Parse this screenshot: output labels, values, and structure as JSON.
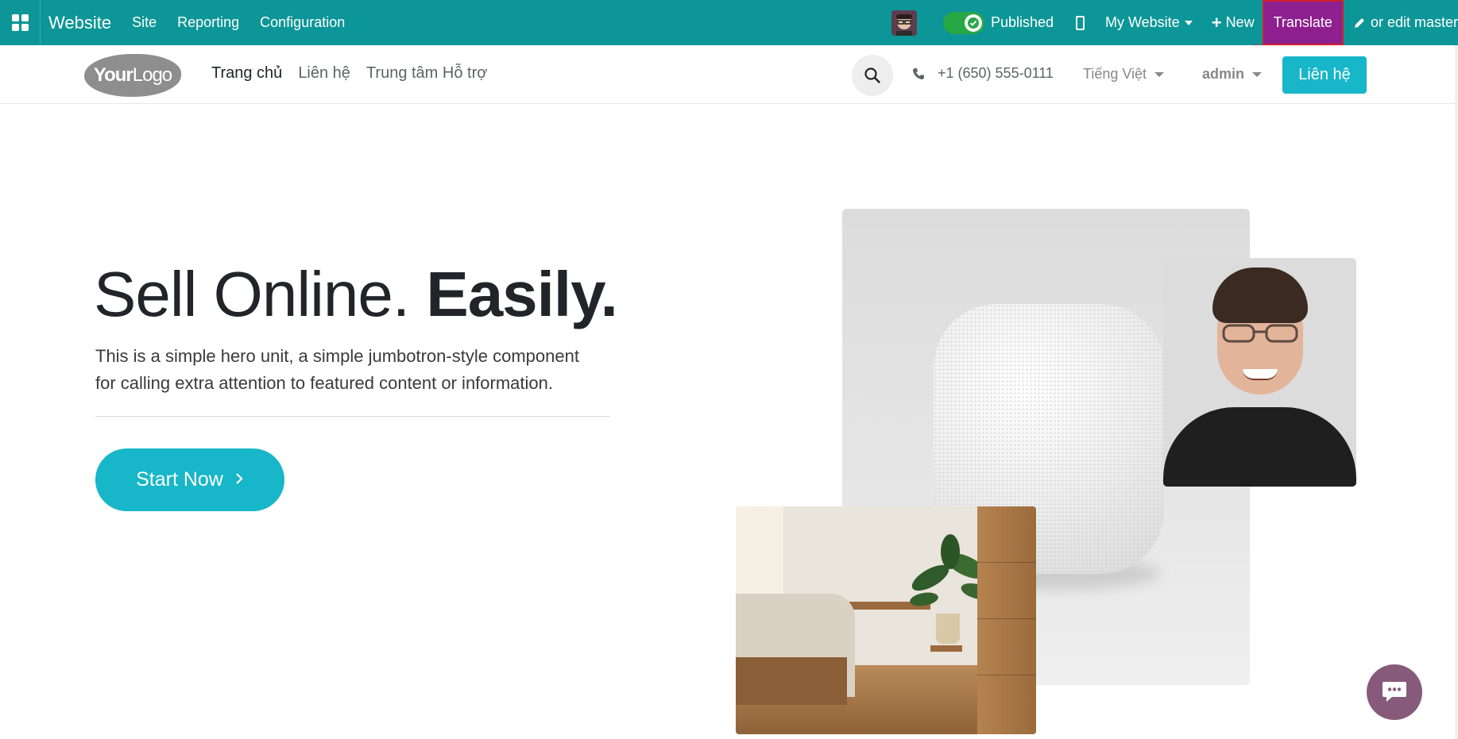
{
  "topbar": {
    "brand": "Website",
    "menu": [
      "Site",
      "Reporting",
      "Configuration"
    ],
    "published_label": "Published",
    "website_selector": "My Website",
    "new_label": "New",
    "translate_label": "Translate",
    "edit_label": "or edit master"
  },
  "header": {
    "logo_text_bold": "Your",
    "logo_text_rest": "Logo",
    "nav": [
      "Trang chủ",
      "Liên hệ",
      "Trung tâm Hỗ trợ"
    ],
    "phone": "+1 (650) 555-0111",
    "language": "Tiếng Việt",
    "user": "admin",
    "contact_button": "Liên hệ"
  },
  "hero": {
    "title_light": "Sell Online. ",
    "title_bold": "Easily.",
    "description_line1": "This is a simple hero unit, a simple jumbotron-style component",
    "description_line2": "for calling extra attention to featured content or information.",
    "cta_label": "Start Now"
  },
  "colors": {
    "topbar_bg": "#0d9697",
    "translate_bg": "#8d1f8f",
    "highlight_border": "#d11f2a",
    "primary": "#17b6c8",
    "chat_bubble": "#875a7b"
  },
  "icons": {
    "apps": "apps-grid-icon",
    "toggle": "check-toggle-icon",
    "mobile": "mobile-icon",
    "plus": "plus-icon",
    "pencil": "pencil-icon",
    "search": "search-icon",
    "phone": "phone-icon",
    "chevron": "chevron-right-icon",
    "chat": "chat-icon"
  }
}
